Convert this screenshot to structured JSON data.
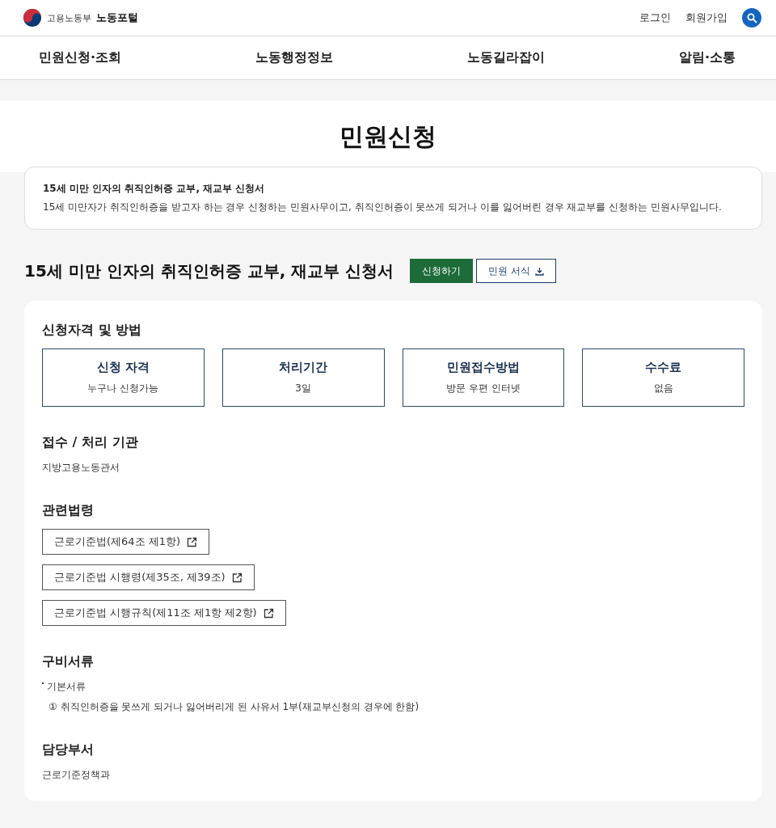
{
  "header": {
    "brand_org": "고용노동부",
    "brand_name": "노동포털",
    "links": [
      "로그인",
      "회원가입"
    ]
  },
  "nav": [
    "민원신청·조회",
    "노동행정정보",
    "노동길라잡이",
    "알림·소통"
  ],
  "page_title": "민원신청",
  "intro": {
    "title": "15세 미만 인자의 취직인허증 교부, 재교부 신청서",
    "text": "15세 미만자가 취직인허증을 받고자 하는 경우 신청하는 민원사무이고, 취직인허증이 못쓰게 되거나 이를 잃어버린 경우 재교부를 신청하는 민원사무입니다."
  },
  "form_title": "15세 미만 인자의 취직인허증 교부, 재교부 신청서",
  "actions": [
    {
      "label": "신청하기",
      "kind": "primary"
    },
    {
      "label": "민원 서식",
      "kind": "download"
    }
  ],
  "sections": [
    {
      "kind": "cards",
      "title": "신청자격 및 방법",
      "cards": [
        {
          "label": "신청 자격",
          "value": "누구나 신청가능"
        },
        {
          "label": "처리기간",
          "value": "3일"
        },
        {
          "label": "민원접수방법",
          "value": "방문 우편 인터넷"
        },
        {
          "label": "수수료",
          "value": "없음"
        }
      ]
    },
    {
      "kind": "text",
      "title": "접수 / 처리 기관",
      "text": "지방고용노동관서"
    },
    {
      "kind": "links",
      "title": "관련법령",
      "links": [
        "근로기준법(제64조 제1항)",
        "근로기준법 시행령(제35조, 제39조)",
        "근로기준법 시행규칙(제11조 제1항 제2항)"
      ]
    },
    {
      "kind": "docs",
      "title": "구비서류",
      "group": "기본서류",
      "items": [
        "① 취직인허증을 못쓰게 되거나 잃어버리게 된 사유서 1부(재교부신청의 경우에 한함)"
      ]
    },
    {
      "kind": "text",
      "title": "담당부서",
      "text": "근로기준정책과"
    }
  ]
}
